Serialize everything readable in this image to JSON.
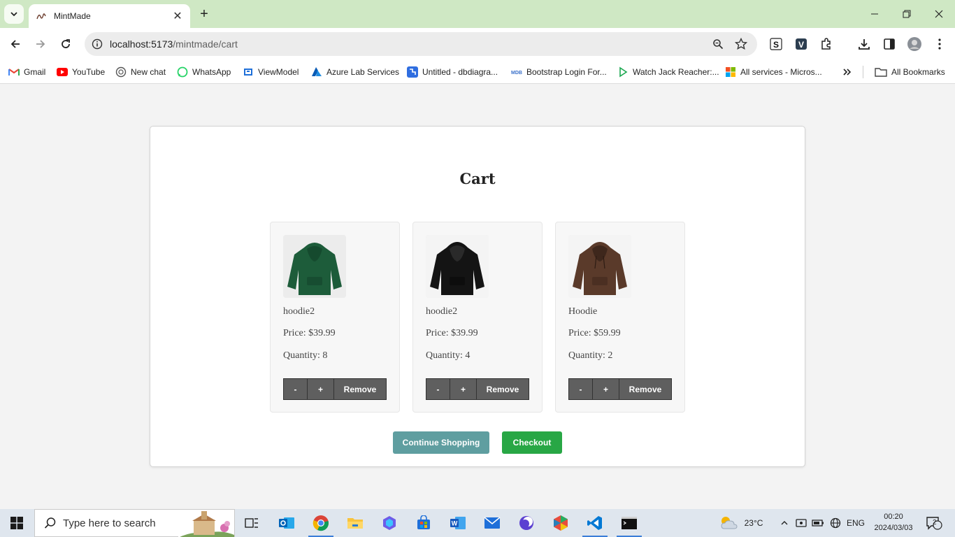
{
  "browser": {
    "tab_title": "MintMade",
    "url_host": "localhost:5173",
    "url_path": "/mintmade/cart",
    "bookmarks": [
      {
        "label": "Gmail",
        "icon": "gmail-icon"
      },
      {
        "label": "YouTube",
        "icon": "youtube-icon"
      },
      {
        "label": "New chat",
        "icon": "chatgpt-icon"
      },
      {
        "label": "WhatsApp",
        "icon": "whatsapp-icon"
      },
      {
        "label": "ViewModel",
        "icon": "viewmodel-icon"
      },
      {
        "label": "Azure Lab Services",
        "icon": "azure-icon"
      },
      {
        "label": "Untitled - dbdiagra...",
        "icon": "dbdiagram-icon"
      },
      {
        "label": "Bootstrap Login For...",
        "icon": "mdb-icon"
      },
      {
        "label": "Watch Jack Reacher:...",
        "icon": "play-icon"
      },
      {
        "label": "All services - Micros...",
        "icon": "microsoft-icon"
      }
    ],
    "all_bookmarks_label": "All Bookmarks"
  },
  "page": {
    "title": "Cart",
    "items": [
      {
        "name": "hoodie2",
        "price_label": "Price: $39.99",
        "quantity_label": "Quantity: 8",
        "color": "#1d5c3a"
      },
      {
        "name": "hoodie2",
        "price_label": "Price: $39.99",
        "quantity_label": "Quantity: 4",
        "color": "#141414"
      },
      {
        "name": "Hoodie",
        "price_label": "Price: $59.99",
        "quantity_label": "Quantity: 2",
        "color": "#5a3a2a"
      }
    ],
    "minus_label": "-",
    "plus_label": "+",
    "remove_label": "Remove",
    "continue_label": "Continue Shopping",
    "checkout_label": "Checkout"
  },
  "taskbar": {
    "search_placeholder": "Type here to search",
    "weather": "23°C",
    "language": "ENG",
    "time": "00:20",
    "date": "2024/03/03",
    "notifications": "2"
  },
  "colors": {
    "tab_strip": "#cfe8c4",
    "continue_button": "#5f9ea0",
    "checkout_button": "#28a745",
    "qty_button": "#5f5f5f"
  }
}
